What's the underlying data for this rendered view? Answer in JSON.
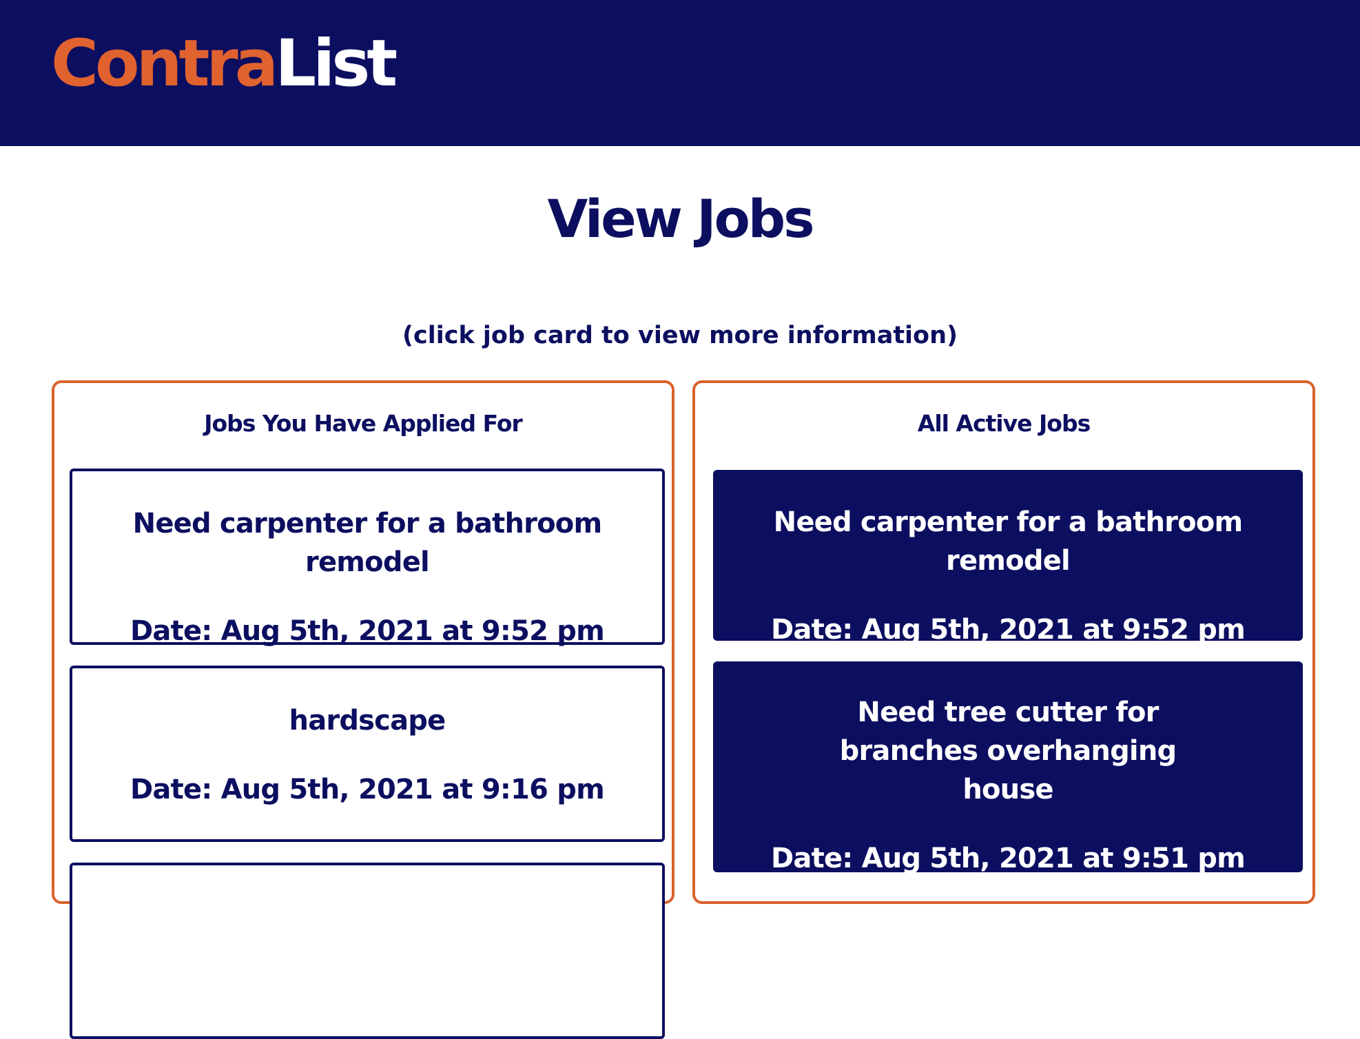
{
  "navbar": {
    "logo_part1": "Contra",
    "logo_part2": "List",
    "colors": {
      "background": "#0c0e60",
      "accent": "#e0622f"
    }
  },
  "main": {
    "title": "View Jobs",
    "subtitle": "(click job card to view more information)"
  },
  "applied_panel": {
    "heading": "Jobs You Have Applied For",
    "jobs": [
      {
        "title": "Need carpenter for a bathroom remodel",
        "date": "Date: Aug 5th, 2021 at 9:52 pm"
      },
      {
        "title": "hardscape",
        "date": "Date: Aug 5th, 2021 at 9:16 pm"
      }
    ]
  },
  "active_panel": {
    "heading": "All Active Jobs",
    "jobs": [
      {
        "title": "Need carpenter for a bathroom remodel",
        "date": "Date: Aug 5th, 2021 at 9:52 pm"
      },
      {
        "title": "Need tree cutter for branches overhanging house",
        "date": "Date: Aug 5th, 2021 at 9:51 pm"
      }
    ]
  }
}
